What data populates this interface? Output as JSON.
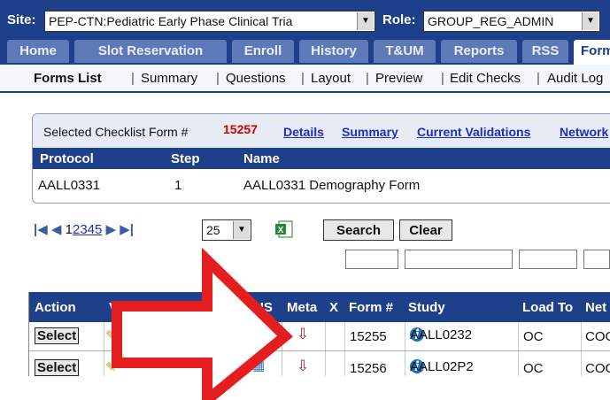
{
  "topbar": {
    "site_label": "Site:",
    "site_value": "PEP-CTN:Pediatric Early Phase Clinical Tria",
    "role_label": "Role:",
    "role_value": "GROUP_REG_ADMIN"
  },
  "tabs": [
    "Home",
    "Slot Reservation",
    "Enroll",
    "History",
    "T&UM",
    "Reports",
    "RSS",
    "Forms"
  ],
  "subnav": [
    "Forms List",
    "Summary",
    "Questions",
    "Layout",
    "Preview",
    "Edit Checks",
    "Audit Log"
  ],
  "checklist": {
    "label": "Selected Checklist Form #",
    "form_number": "15257",
    "links": [
      "Details",
      "Summary",
      "Current Validations",
      "Network"
    ],
    "columns": [
      "Protocol",
      "Step",
      "Name"
    ],
    "row": {
      "protocol": "AALL0331",
      "step": "1",
      "name": "AALL0331 Demography Form"
    }
  },
  "pager": {
    "pages": [
      "1",
      "2",
      "3",
      "4",
      "5"
    ],
    "page_size": "25",
    "search_label": "Search",
    "clear_label": "Clear"
  },
  "grid": {
    "columns": [
      "Action",
      "V",
      "US",
      "Meta",
      "X",
      "Form #",
      "Study",
      "Load To",
      "Net"
    ],
    "rows": [
      {
        "action": "Select",
        "form_no": "15255",
        "study": "AALL0232",
        "load_to": "OC",
        "net": "COG"
      },
      {
        "action": "Select",
        "form_no": "15256",
        "study": "AALL02P2",
        "load_to": "OC",
        "net": "COG"
      }
    ]
  },
  "annotation": {
    "arrow_color": "#e41e1e"
  }
}
